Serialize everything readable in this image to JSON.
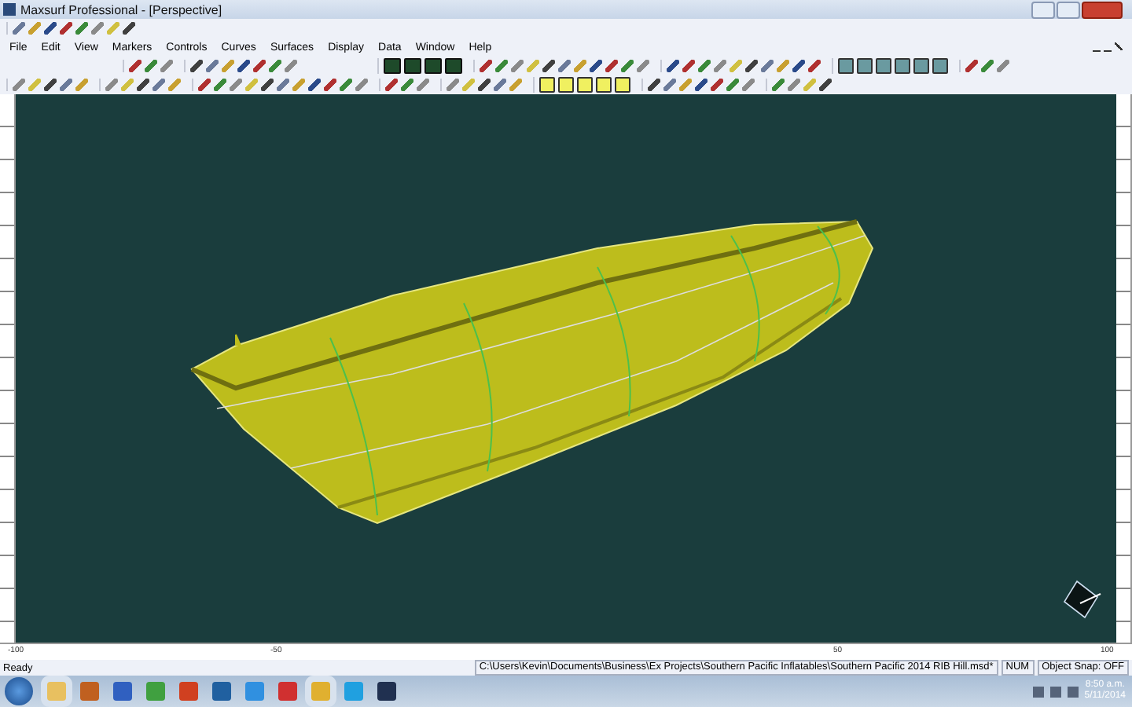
{
  "window": {
    "title": "Maxsurf Professional - [Perspective]"
  },
  "menu": [
    {
      "label": "File"
    },
    {
      "label": "Edit"
    },
    {
      "label": "View"
    },
    {
      "label": "Markers"
    },
    {
      "label": "Controls"
    },
    {
      "label": "Curves"
    },
    {
      "label": "Surfaces"
    },
    {
      "label": "Display"
    },
    {
      "label": "Data"
    },
    {
      "label": "Window"
    },
    {
      "label": "Help"
    }
  ],
  "ruler_bottom": {
    "labels": [
      "-100",
      "-50",
      "50",
      "100"
    ]
  },
  "status_bar": {
    "message": "Ready",
    "file_path": "C:\\Users\\Kevin\\Documents\\Business\\Ex Projects\\Southern Pacific Inflatables\\Southern Pacific 2014 RIB Hill.msd*",
    "num": "NUM",
    "snap": "Object Snap: OFF"
  },
  "taskbar": {
    "time": "8:50 a.m.",
    "date": "5/11/2014"
  }
}
